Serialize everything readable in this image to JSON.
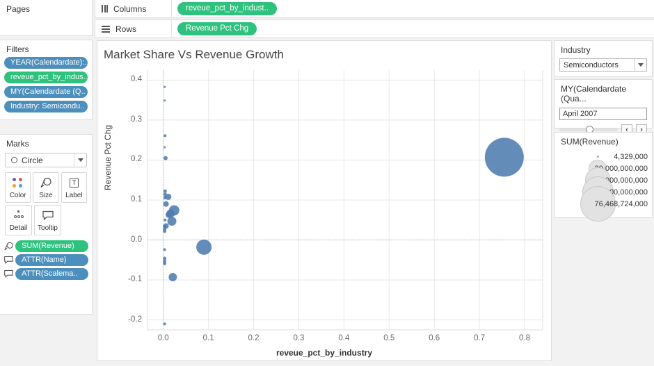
{
  "pages": {
    "title": "Pages"
  },
  "filters": {
    "title": "Filters",
    "items": [
      {
        "label": "YEAR(Calendardate):..",
        "color": "blue"
      },
      {
        "label": "reveue_pct_by_indus..",
        "color": "green"
      },
      {
        "label": "MY(Calendardate (Q..",
        "color": "blue"
      },
      {
        "label": "Industry: Semicondu..",
        "color": "blue"
      }
    ]
  },
  "marks": {
    "title": "Marks",
    "mark_type": "Circle",
    "buttons": [
      {
        "label": "Color",
        "icon": "color-dots-icon"
      },
      {
        "label": "Size",
        "icon": "size-icon"
      },
      {
        "label": "Label",
        "icon": "label-icon"
      },
      {
        "label": "Detail",
        "icon": "detail-icon"
      },
      {
        "label": "Tooltip",
        "icon": "tooltip-icon"
      }
    ],
    "pills": [
      {
        "label": "SUM(Revenue)",
        "color": "green",
        "icon": "size-icon"
      },
      {
        "label": "ATTR(Name)",
        "color": "blue",
        "icon": "tooltip-icon"
      },
      {
        "label": "ATTR(Scalema..",
        "color": "blue",
        "icon": "tooltip-icon"
      }
    ]
  },
  "shelves": {
    "columns_label": "Columns",
    "columns_pill": "reveue_pct_by_indust..",
    "rows_label": "Rows",
    "rows_pill": "Revenue Pct Chg"
  },
  "right": {
    "industry": {
      "title": "Industry",
      "value": "Semiconductors"
    },
    "date": {
      "title": "MY(Calendardate (Qua...",
      "value": "April 2007",
      "prev_label": "‹",
      "next_label": "›"
    },
    "size": {
      "title": "SUM(Revenue)",
      "entries": [
        {
          "label": "4,329,000",
          "diameter": 3
        },
        {
          "label": "20,000,000,000",
          "diameter": 26
        },
        {
          "label": "40,000,000,000",
          "diameter": 37
        },
        {
          "label": "60,000,000,000",
          "diameter": 45
        },
        {
          "label": "76,468,724,000",
          "diameter": 51
        }
      ]
    }
  },
  "colors": {
    "mark_blue": "#4e7cae",
    "pill_green": "#2ec27e",
    "pill_blue": "#4c8fbd",
    "grid": "#e8e8e8"
  },
  "chart_data": {
    "type": "scatter",
    "title": "Market Share Vs Revenue Growth",
    "xlabel": "reveue_pct_by_industry",
    "ylabel": "Revenue Pct Chg",
    "xlim": [
      -0.035,
      0.84
    ],
    "ylim": [
      -0.225,
      0.425
    ],
    "xticks": [
      0.0,
      0.1,
      0.2,
      0.3,
      0.4,
      0.5,
      0.6,
      0.7,
      0.8
    ],
    "xtick_labels": [
      "0.0",
      "0.1",
      "0.2",
      "0.3",
      "0.4",
      "0.5",
      "0.6",
      "0.7",
      "0.8"
    ],
    "yticks": [
      -0.2,
      -0.1,
      0.0,
      0.1,
      0.2,
      0.3,
      0.4
    ],
    "ytick_labels": [
      "-0.2",
      "-0.1",
      "0.0",
      "0.1",
      "0.2",
      "0.3",
      "0.4"
    ],
    "grid": true,
    "legend": "none",
    "size_field": "SUM(Revenue)",
    "reference_lines": [
      {
        "axis": "x",
        "value": 0.0
      },
      {
        "axis": "y",
        "value": 0.0
      }
    ],
    "points": [
      {
        "x": 0.003,
        "y": 0.383,
        "size": 3
      },
      {
        "x": 0.003,
        "y": 0.349,
        "size": 3
      },
      {
        "x": 0.004,
        "y": 0.261,
        "size": 4
      },
      {
        "x": 0.003,
        "y": 0.232,
        "size": 3
      },
      {
        "x": 0.005,
        "y": 0.205,
        "size": 6
      },
      {
        "x": 0.004,
        "y": 0.122,
        "size": 5
      },
      {
        "x": 0.004,
        "y": 0.114,
        "size": 5
      },
      {
        "x": 0.004,
        "y": 0.106,
        "size": 5
      },
      {
        "x": 0.011,
        "y": 0.108,
        "size": 9
      },
      {
        "x": 0.006,
        "y": 0.09,
        "size": 8
      },
      {
        "x": 0.024,
        "y": 0.074,
        "size": 15
      },
      {
        "x": 0.016,
        "y": 0.066,
        "size": 12
      },
      {
        "x": 0.012,
        "y": 0.063,
        "size": 9
      },
      {
        "x": 0.019,
        "y": 0.047,
        "size": 13
      },
      {
        "x": 0.004,
        "y": 0.05,
        "size": 4
      },
      {
        "x": 0.006,
        "y": 0.035,
        "size": 8
      },
      {
        "x": 0.003,
        "y": 0.034,
        "size": 5
      },
      {
        "x": 0.003,
        "y": 0.027,
        "size": 5
      },
      {
        "x": 0.003,
        "y": 0.022,
        "size": 5
      },
      {
        "x": 0.003,
        "y": -0.024,
        "size": 4
      },
      {
        "x": 0.003,
        "y": -0.046,
        "size": 5
      },
      {
        "x": 0.003,
        "y": -0.053,
        "size": 5
      },
      {
        "x": 0.003,
        "y": -0.059,
        "size": 5
      },
      {
        "x": 0.09,
        "y": -0.018,
        "size": 22
      },
      {
        "x": 0.021,
        "y": -0.093,
        "size": 12
      },
      {
        "x": 0.003,
        "y": -0.21,
        "size": 4
      },
      {
        "x": 0.755,
        "y": 0.207,
        "size": 56
      }
    ]
  }
}
